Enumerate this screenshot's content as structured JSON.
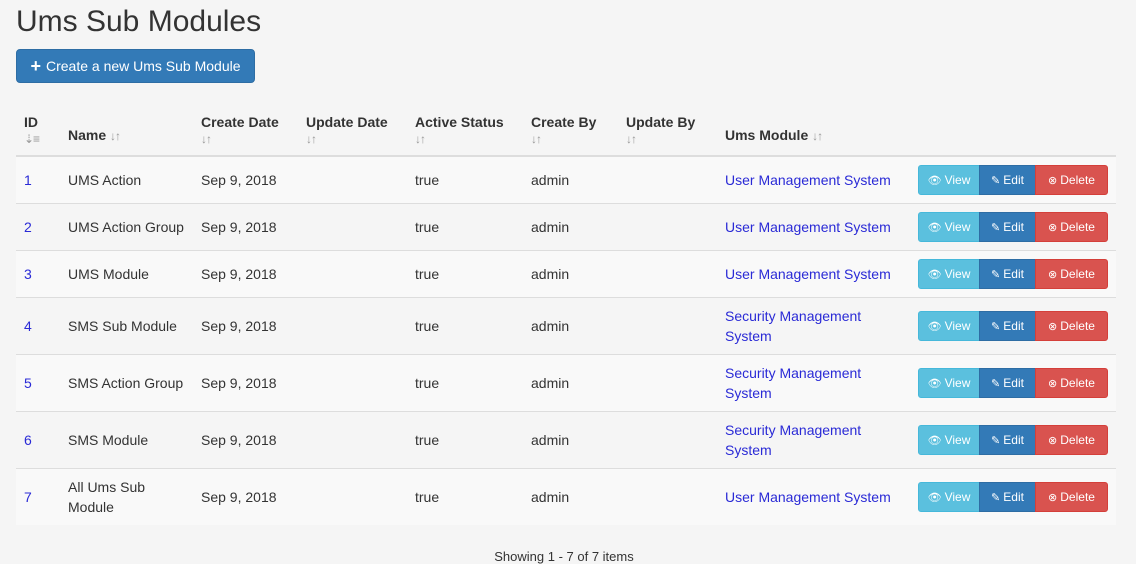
{
  "page": {
    "title": "Ums Sub Modules",
    "create_button_label": "Create a new Ums Sub Module",
    "footer_text": "Showing 1 - 7 of 7 items"
  },
  "table": {
    "columns": {
      "id": "ID",
      "name": "Name",
      "create_date": "Create Date",
      "update_date": "Update Date",
      "active_status": "Active Status",
      "create_by": "Create By",
      "update_by": "Update By",
      "ums_module": "Ums Module"
    },
    "sort_icon": "sort-icon",
    "action_labels": {
      "view": "View",
      "edit": "Edit",
      "delete": "Delete"
    },
    "rows": [
      {
        "id": "1",
        "name": "UMS Action",
        "create_date": "Sep 9, 2018",
        "update_date": "",
        "active_status": "true",
        "create_by": "admin",
        "update_by": "",
        "ums_module": "User Management System"
      },
      {
        "id": "2",
        "name": "UMS Action Group",
        "create_date": "Sep 9, 2018",
        "update_date": "",
        "active_status": "true",
        "create_by": "admin",
        "update_by": "",
        "ums_module": "User Management System"
      },
      {
        "id": "3",
        "name": "UMS Module",
        "create_date": "Sep 9, 2018",
        "update_date": "",
        "active_status": "true",
        "create_by": "admin",
        "update_by": "",
        "ums_module": "User Management System"
      },
      {
        "id": "4",
        "name": "SMS Sub Module",
        "create_date": "Sep 9, 2018",
        "update_date": "",
        "active_status": "true",
        "create_by": "admin",
        "update_by": "",
        "ums_module": "Security Management System"
      },
      {
        "id": "5",
        "name": "SMS Action Group",
        "create_date": "Sep 9, 2018",
        "update_date": "",
        "active_status": "true",
        "create_by": "admin",
        "update_by": "",
        "ums_module": "Security Management System"
      },
      {
        "id": "6",
        "name": "SMS Module",
        "create_date": "Sep 9, 2018",
        "update_date": "",
        "active_status": "true",
        "create_by": "admin",
        "update_by": "",
        "ums_module": "Security Management System"
      },
      {
        "id": "7",
        "name": "All Ums Sub Module",
        "create_date": "Sep 9, 2018",
        "update_date": "",
        "active_status": "true",
        "create_by": "admin",
        "update_by": "",
        "ums_module": "User Management System"
      }
    ]
  },
  "colors": {
    "primary": "#337ab7",
    "info": "#5bc0de",
    "danger": "#d9534f",
    "link": "#2a2ad6"
  }
}
